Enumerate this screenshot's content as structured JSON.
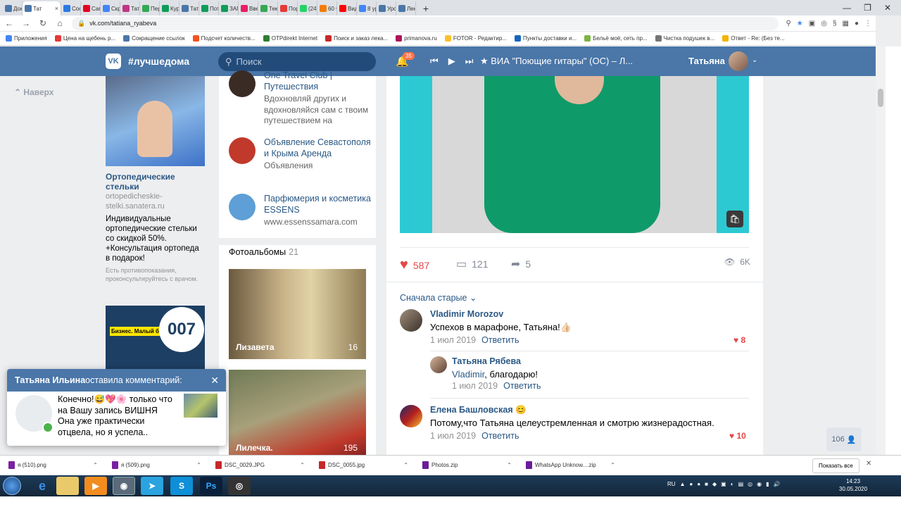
{
  "browser": {
    "tabs": [
      {
        "label": "Док",
        "color": "#4a76a8",
        "active": false
      },
      {
        "label": "Тат",
        "color": "#4a76a8",
        "active": true
      },
      {
        "label": "Соо",
        "color": "#2a7ae2",
        "active": false
      },
      {
        "label": "Сам",
        "color": "#e60023",
        "active": false
      },
      {
        "label": "Скр",
        "color": "#4285f4",
        "active": false
      },
      {
        "label": "Тат",
        "color": "#c13584",
        "active": false
      },
      {
        "label": "Пер",
        "color": "#34a853",
        "active": false
      },
      {
        "label": "Кур",
        "color": "#0f9d58",
        "active": false
      },
      {
        "label": "Тат",
        "color": "#4a76a8",
        "active": false
      },
      {
        "label": "Пот",
        "color": "#0f9d58",
        "active": false
      },
      {
        "label": "ЗАГ",
        "color": "#0f9d58",
        "active": false
      },
      {
        "label": "Вве",
        "color": "#e91e63",
        "active": false
      },
      {
        "label": "Тек",
        "color": "#34a853",
        "active": false
      },
      {
        "label": "Пор",
        "color": "#e53935",
        "active": false
      },
      {
        "label": "(24)",
        "color": "#25d366",
        "active": false
      },
      {
        "label": "60 ч",
        "color": "#f57c00",
        "active": false
      },
      {
        "label": "Вид",
        "color": "#ff0000",
        "active": false
      },
      {
        "label": "8 ур",
        "color": "#4285f4",
        "active": false
      },
      {
        "label": "Уро",
        "color": "#4a76a8",
        "active": false
      },
      {
        "label": "Лен",
        "color": "#4a76a8",
        "active": false
      }
    ],
    "url": "vk.com/tatiana_ryabeva",
    "bookmarks": [
      {
        "label": "Приложения",
        "color": "#4285f4"
      },
      {
        "label": "Цена на щебень р...",
        "color": "#e53935"
      },
      {
        "label": "Сокращение ссылок",
        "color": "#4a76a8"
      },
      {
        "label": "Подсчет количеств...",
        "color": "#f4511e"
      },
      {
        "label": "OTPdirekt Internet",
        "color": "#2e7d32"
      },
      {
        "label": "Поиск и заказ лека...",
        "color": "#c62828"
      },
      {
        "label": "primanova.ru",
        "color": "#ad1457"
      },
      {
        "label": "FOTOR - Редактир...",
        "color": "#fbc02d"
      },
      {
        "label": "Пункты доставки и...",
        "color": "#1565c0"
      },
      {
        "label": "Бельё моё, сеть пр...",
        "color": "#7cb342"
      },
      {
        "label": "Чистка подушек в...",
        "color": "#757575"
      },
      {
        "label": "Ответ - Re: (Без те...",
        "color": "#f4b400"
      }
    ]
  },
  "vk": {
    "hashtag": "#лучшедома",
    "logo": "VK",
    "search_placeholder": "Поиск",
    "notif_count": "35",
    "track": "★ ВИА \"Поющие гитары\" (ОС) – Л...",
    "user_name": "Татьяна",
    "up_label": "Наверх",
    "ad1": {
      "title": "Ортопедические стельки",
      "url": "ortopedicheskie-stelki.sanatera.ru",
      "desc": "Индивидуальные ортопедические стельки со скидкой 50%. +Консультация ортопеда в подарок!",
      "note": "Есть противопоказания, проконсультируйтесь с врачом."
    },
    "ad2": {
      "tag": "Бизнес. Малый бизнес.",
      "number": "007"
    },
    "groups": [
      {
        "name": "One Travel Club | Путешествия",
        "sub": "Вдохновляй других и вдохновляйся сам с твоим путешествием на",
        "color": "#3b2b25"
      },
      {
        "name": "Объявление Севастополя и Крыма Аренда",
        "sub": "Объявления",
        "color": "#c0392b"
      },
      {
        "name": "Парфюмерия и косметика ESSENS",
        "sub": "www.essenssamara.com",
        "color": "#5d9fd6"
      }
    ],
    "albums_label": "Фотоальбомы",
    "albums_count": "21",
    "albums": [
      {
        "name": "Лизавета",
        "count": "16"
      },
      {
        "name": "Лилечка.",
        "count": "195"
      }
    ],
    "post": {
      "likes": "587",
      "comments": "121",
      "shares": "5",
      "views": "6K",
      "sort_label": "Сначала старые"
    },
    "comments": [
      {
        "author": "Vladimir Morozov",
        "text": "Успехов в марафоне, Татьяна!👍🏻",
        "date": "1 июл 2019",
        "reply": "Ответить",
        "likes": "8"
      },
      {
        "author": "Татьяна Рябева",
        "mention": "Vladimir",
        "text": ", благодарю!",
        "date": "1 июл 2019",
        "reply": "Ответить"
      },
      {
        "author": "Елена Башловская 😊",
        "text": "Потому,что Татьяна целеустремленная и смотрю жизнерадостная.",
        "date": "1 июл 2019",
        "reply": "Ответить",
        "likes": "10"
      }
    ],
    "friends_online": "106"
  },
  "toast": {
    "author": "Татьяна Ильина",
    "action": " оставила комментарий:",
    "text": "Конечно!😅💖🌸 только что на Вашу запись ВИШНЯ Она уже практически отцвела, но я успела.."
  },
  "downloads": {
    "items": [
      {
        "name": "я (510).png",
        "color": "#7b1fa2"
      },
      {
        "name": "я (509).png",
        "color": "#7b1fa2"
      },
      {
        "name": "DSC_0029.JPG",
        "color": "#c62828"
      },
      {
        "name": "DSC_0055.jpg",
        "color": "#c62828"
      },
      {
        "name": "Photos.zip",
        "color": "#6a1b9a"
      },
      {
        "name": "WhatsApp Unknow....zip",
        "color": "#6a1b9a"
      }
    ],
    "show_all": "Показать все"
  },
  "taskbar": {
    "lang": "RU",
    "time": "14:23",
    "date": "30.05.2020"
  }
}
